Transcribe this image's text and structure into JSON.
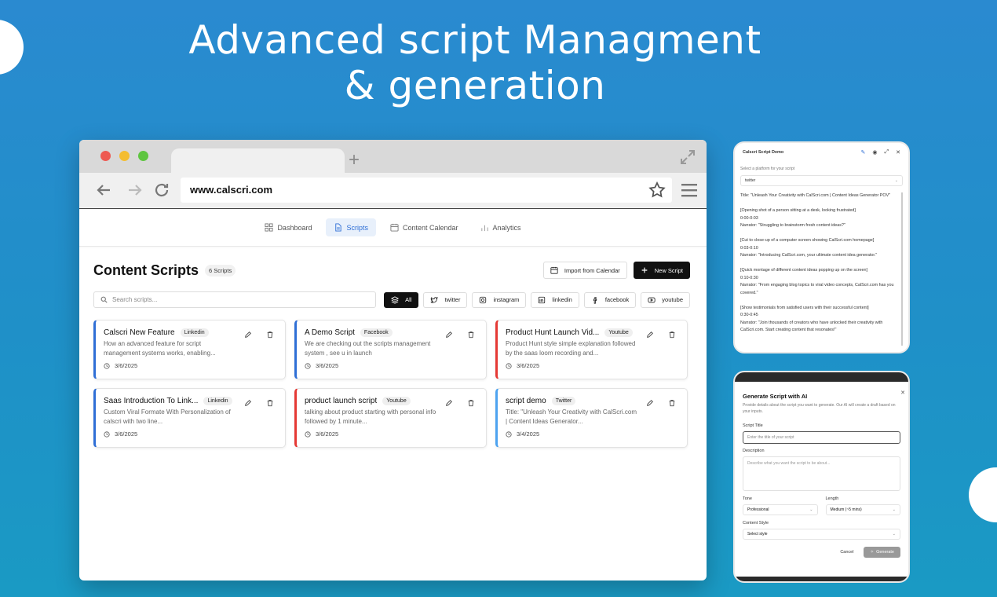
{
  "hero": {
    "line1": "Advanced script Managment",
    "line2": "& generation"
  },
  "browser": {
    "url": "www.calscri.com"
  },
  "nav": [
    {
      "label": "Dashboard",
      "icon": "grid-icon",
      "active": false
    },
    {
      "label": "Scripts",
      "icon": "file-icon",
      "active": true
    },
    {
      "label": "Content Calendar",
      "icon": "calendar-icon",
      "active": false
    },
    {
      "label": "Analytics",
      "icon": "bar-chart-icon",
      "active": false
    }
  ],
  "page": {
    "title": "Content Scripts",
    "count": "6 Scripts",
    "import_label": "Import from Calendar",
    "new_label": "New Script",
    "search_placeholder": "Search scripts..."
  },
  "filters": [
    {
      "label": "All",
      "icon": "layers-icon",
      "selected": true
    },
    {
      "label": "twitter",
      "icon": "twitter-icon",
      "selected": false
    },
    {
      "label": "instagram",
      "icon": "instagram-icon",
      "selected": false
    },
    {
      "label": "linkedin",
      "icon": "linkedin-icon",
      "selected": false
    },
    {
      "label": "facebook",
      "icon": "facebook-icon",
      "selected": false
    },
    {
      "label": "youtube",
      "icon": "youtube-icon",
      "selected": false
    }
  ],
  "cards": [
    {
      "title": "Calscri New Feature",
      "badge": "Linkedin",
      "desc": "How an advanced feature for script management systems works, enabling...",
      "date": "3/6/2025",
      "color": "#2f6fd6"
    },
    {
      "title": "A Demo Script",
      "badge": "Facebook",
      "desc": "We are checking out the scripts management system , see u in launch",
      "date": "3/6/2025",
      "color": "#2f6fd6"
    },
    {
      "title": "Product Hunt Launch Vid...",
      "badge": "Youtube",
      "desc": "Product Hunt style simple explanation followed by the saas loom recording and...",
      "date": "3/6/2025",
      "color": "#e53935"
    },
    {
      "title": "Saas Introduction To Link...",
      "badge": "Linkedin",
      "desc": "Custom Viral Formate With Personalization of calscri with two line...",
      "date": "3/6/2025",
      "color": "#2f6fd6"
    },
    {
      "title": "product launch script",
      "badge": "Youtube",
      "desc": "talking about product starting with personal info followed by 1 minute...",
      "date": "3/6/2025",
      "color": "#e53935"
    },
    {
      "title": "script demo",
      "badge": "Twitter",
      "desc": "Title: \"Unleash Your Creativity with CalScri.com | Content Ideas Generator...",
      "date": "3/4/2025",
      "color": "#4da3f0"
    }
  ],
  "demo_panel": {
    "title": "Calscri Script Demo",
    "platform_label": "Select a platform for your script",
    "platform_value": "twitter",
    "lines": [
      "Title: \"Unleash Your Creativity with CalScri.com | Content Ideas Generator POV\"",
      "",
      "[Opening shot of a person sitting at a desk, looking frustrated]",
      "0:00-0:03",
      "Narrator: \"Struggling to brainstorm fresh content ideas?\"",
      "",
      "[Cut to close-up of a computer screen showing CalScri.com homepage]",
      "0:03-0:10",
      "Narrator: \"Introducing CalScri.com, your ultimate content idea generator.\"",
      "",
      "[Quick montage of different content ideas popping up on the screen]",
      "0:10-0:30",
      "Narrator: \"From engaging blog topics to viral video concepts, CalScri.com has you covered.\"",
      "",
      "[Show testimonials from satisfied users with their successful content]",
      "0:30-0:45",
      "Narrator: \"Join thousands of creators who have unlocked their creativity with CalScri.com. Start creating content that resonates!\""
    ]
  },
  "gen_panel": {
    "title": "Generate Script with AI",
    "subtitle": "Provide details about the script you want to generate. Our AI will create a draft based on your inputs.",
    "script_title_label": "Script Title",
    "script_title_placeholder": "Enter the title of your script",
    "description_label": "Description",
    "description_placeholder": "Describe what you want the script to be about...",
    "tone_label": "Tone",
    "tone_value": "Professional",
    "length_label": "Length",
    "length_value": "Medium (~5 mins)",
    "style_label": "Content Style",
    "style_value": "Select style",
    "cancel_label": "Cancel",
    "generate_label": "Generate"
  }
}
